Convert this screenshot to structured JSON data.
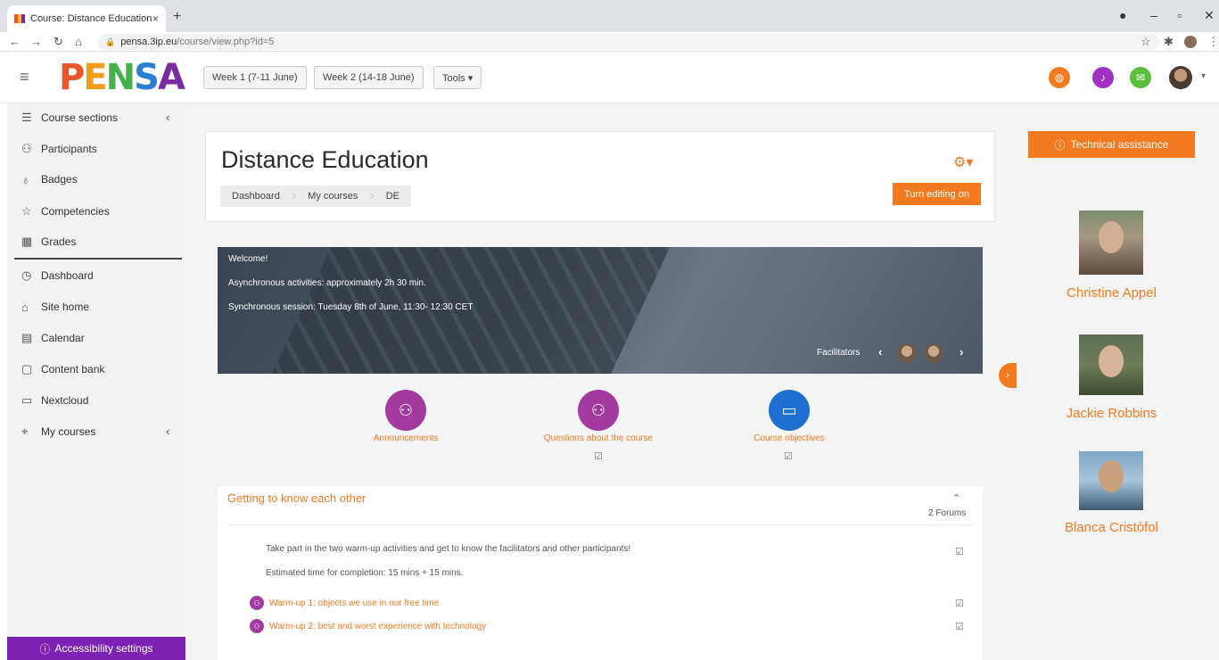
{
  "browser": {
    "tab_title": "Course: Distance Education",
    "tab_close": "×",
    "new_tab": "+",
    "url_host": "pensa.3ip.eu",
    "url_path": "/course/view.php?id=5"
  },
  "navbar": {
    "logo": [
      "P",
      "E",
      "N",
      "S",
      "A"
    ],
    "buttons": [
      "Week 1 (7-11 June)",
      "Week 2 (14-18 June)",
      "Tools ▾"
    ]
  },
  "drawer": {
    "items": [
      {
        "label": "Course sections",
        "icon": "list-icon"
      },
      {
        "label": "Participants",
        "icon": "users-icon"
      },
      {
        "label": "Badges",
        "icon": "badge-icon"
      },
      {
        "label": "Competencies",
        "icon": "star-icon"
      },
      {
        "label": "Grades",
        "icon": "grades-icon"
      },
      {
        "label": "Dashboard",
        "icon": "dashboard-icon"
      },
      {
        "label": "Site home",
        "icon": "home-icon"
      },
      {
        "label": "Calendar",
        "icon": "calendar-icon"
      },
      {
        "label": "Content bank",
        "icon": "content-bank-icon"
      },
      {
        "label": "Nextcloud",
        "icon": "folder-icon"
      },
      {
        "label": "My courses",
        "icon": "graduation-cap-icon"
      }
    ],
    "accessibility": "Accessibility settings"
  },
  "header": {
    "title": "Distance Education",
    "breadcrumb": [
      "Dashboard",
      "My courses",
      "DE"
    ],
    "edit_button": "Turn editing on"
  },
  "banner": {
    "lines": [
      "Welcome!",
      "Asynchronous activities: approximately 2h 30 min.",
      "Synchronous session: Tuesday 8th of June, 11:30- 12:30 CET"
    ],
    "facilitators_label": "Facilitators"
  },
  "quick_links": [
    {
      "label": "Announcements",
      "color": "#a33a9f"
    },
    {
      "label": "Questions about the course",
      "color": "#a33a9f"
    },
    {
      "label": "Course objectives",
      "color": "#1f6fd1"
    }
  ],
  "section": {
    "title": "Getting to know each other",
    "count": "2 Forums",
    "description": "Take part in the two warm-up activities and get to know the facilitators and other participants!",
    "estimate": "Estimated time for completion: 15 mins + 15 mins.",
    "activities": [
      "Warm-up 1: objects we use in our free time",
      "Warm-up 2: best and worst experience with technology"
    ]
  },
  "right": {
    "tech_button": "Technical assistance",
    "facilitators": [
      "Christine Appel",
      "Jackie Robbins",
      "Blanca Cristòfol"
    ]
  },
  "colors": {
    "accent": "#f47a20",
    "purple": "#7d22b5",
    "circle_purple": "#a33a9f",
    "circle_blue": "#1f6fd1"
  }
}
